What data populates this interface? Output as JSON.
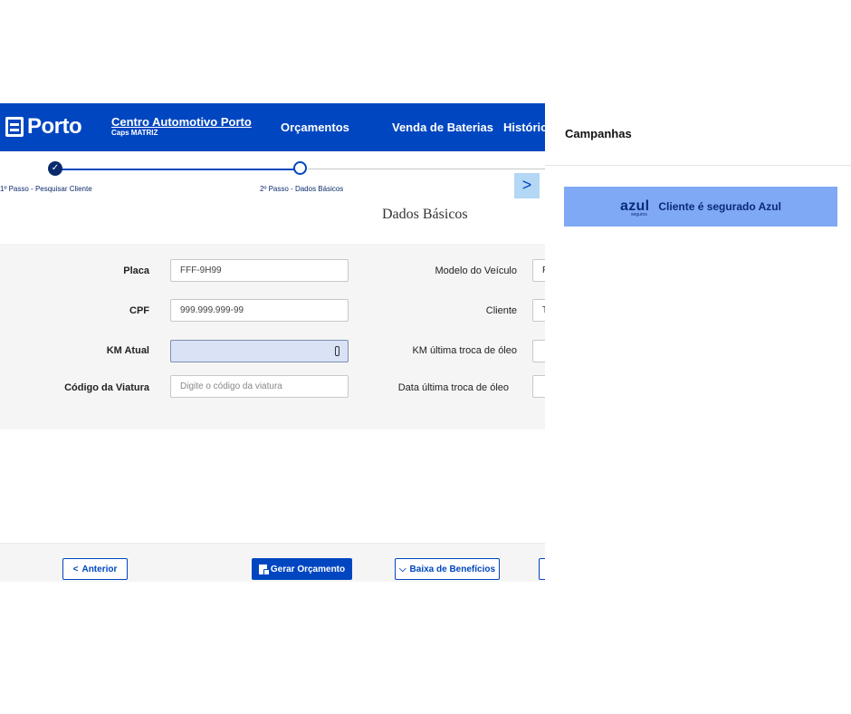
{
  "header": {
    "logo_text": "Porto",
    "company_name": "Centro Automotivo Porto",
    "company_sub": "Caps MATRIZ",
    "nav": [
      "Orçamentos",
      "Venda de Baterias",
      "Históric"
    ]
  },
  "stepper": {
    "step1_label": "1º Passo - Pesquisar Cliente",
    "step2_label": "2º Passo - Dados Básicos",
    "next_glyph": ">"
  },
  "form": {
    "section_title": "Dados Básicos",
    "placa_label": "Placa",
    "placa_value": "FFF-9H99",
    "cpf_label": "CPF",
    "cpf_value": "999.999.999-99",
    "km_label": "KM Atual",
    "km_value": "",
    "viatura_label": "Código da Viatura",
    "viatura_placeholder": "Digite o código da viatura",
    "modelo_label": "Modelo do Veículo",
    "modelo_value": "F",
    "cliente_label": "Cliente",
    "cliente_value": "T",
    "km_oleo_label": "KM última troca de óleo",
    "data_oleo_label": "Data última troca de óleo"
  },
  "actions": {
    "prev_label": "Anterior",
    "gerar_label": "Gerar Orçamento",
    "baixa_label": "Baixa de Benefícios"
  },
  "campaigns": {
    "title": "Campanhas",
    "banner_brand": "azul",
    "banner_brand_sub": "seguros",
    "banner_text": "Cliente é segurado Azul",
    "banner_color": "#7fa9f5"
  },
  "colors": {
    "brand_blue": "#0046c0",
    "dark_blue": "#0b2a6b"
  }
}
